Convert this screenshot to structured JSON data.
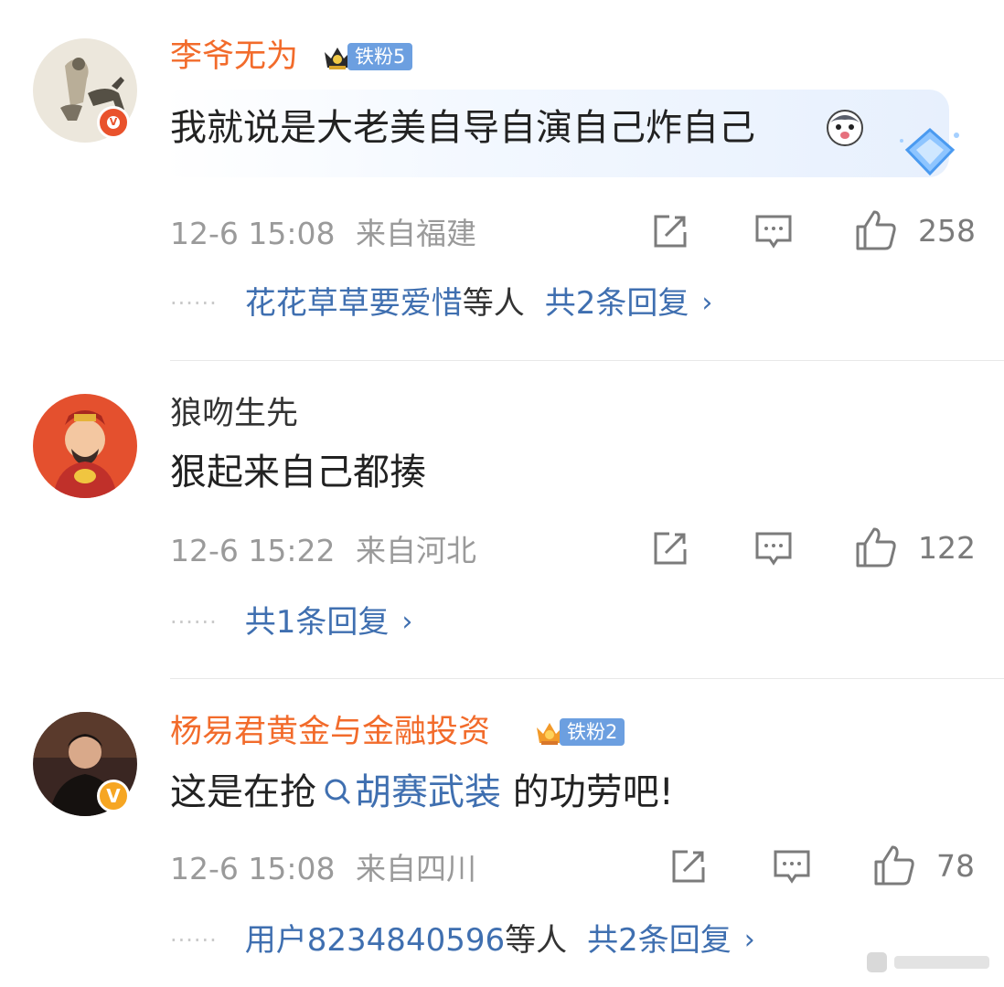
{
  "comments": [
    {
      "username": "李爷无为",
      "fan_badge": "铁粉5",
      "text": "我就说是大老美自导自演自己炸自己",
      "time": "12-6 15:08",
      "location": "来自福建",
      "likes": "258",
      "reply_names": "花花草草要爱惜",
      "reply_names_suffix": "等人",
      "reply_total": "共2条回复",
      "chevron": "›"
    },
    {
      "username": "狼吻生先",
      "text": "狠起来自己都揍",
      "time": "12-6 15:22",
      "location": "来自河北",
      "likes": "122",
      "reply_total": "共1条回复",
      "chevron": "›"
    },
    {
      "username": "杨易君黄金与金融投资",
      "fan_badge": "铁粉2",
      "text_prefix": "这是在抢",
      "search_tag": "胡赛武装",
      "text_suffix": " 的功劳吧!",
      "time": "12-6 15:08",
      "location": "来自四川",
      "likes": "78",
      "reply_names": "用户8234840596",
      "reply_names_suffix": "等人",
      "reply_total": "共2条回复",
      "chevron": "›"
    }
  ],
  "dots": "······",
  "icons": {
    "share": "share-icon",
    "comment": "comment-icon",
    "like": "like-icon",
    "verified": "verified-badge-icon",
    "crown": "crown-icon",
    "search": "search-icon",
    "emoji": "husky-emoji-icon",
    "diamond": "diamond-sticker-icon"
  },
  "colors": {
    "vip_name": "#f26b2b",
    "link": "#3f6fb0",
    "meta": "#9a9a9a",
    "fan_badge": "#6c9fe0"
  }
}
